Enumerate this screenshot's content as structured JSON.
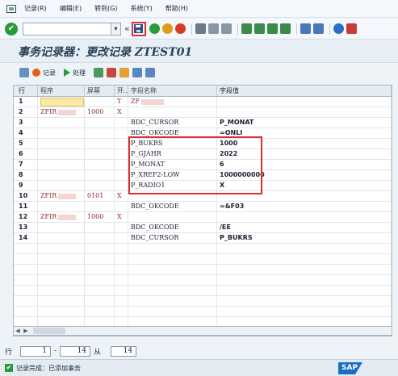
{
  "menu": {
    "items": [
      "记录(R)",
      "编辑(E)",
      "转到(G)",
      "系统(Y)",
      "帮助(H)"
    ]
  },
  "toolbar": {
    "command_value": "",
    "icons": [
      "ok-icon",
      "save-icon",
      "back-icon",
      "exit-icon",
      "cancel-icon",
      "print-icon",
      "find-icon",
      "find-next-icon",
      "first-page-icon",
      "prev-page-icon",
      "next-page-icon",
      "last-page-icon",
      "new-session-icon",
      "shortcut-icon",
      "help-icon",
      "layout-icon"
    ]
  },
  "title": "事务记录器：更改记录 ZTEST01",
  "app_toolbar": {
    "record_label": "记录",
    "process_label": "处理"
  },
  "table": {
    "headers": [
      "行",
      "程序",
      "屏幕",
      "开...",
      "字段名称",
      "字段值"
    ],
    "rows": [
      {
        "row": "1",
        "program": "",
        "screen": "",
        "start": "T",
        "field": "ZF",
        "value": ""
      },
      {
        "row": "2",
        "program": "ZFIR",
        "screen": "1000",
        "start": "X",
        "field": "",
        "value": ""
      },
      {
        "row": "3",
        "program": "",
        "screen": "",
        "start": "",
        "field": "BDC_CURSOR",
        "value": "P_MONAT"
      },
      {
        "row": "4",
        "program": "",
        "screen": "",
        "start": "",
        "field": "BDC_OKCODE",
        "value": "=ONLI"
      },
      {
        "row": "5",
        "program": "",
        "screen": "",
        "start": "",
        "field": "P_BUKRS",
        "value": "1000"
      },
      {
        "row": "6",
        "program": "",
        "screen": "",
        "start": "",
        "field": "P_GJAHR",
        "value": "2022"
      },
      {
        "row": "7",
        "program": "",
        "screen": "",
        "start": "",
        "field": "P_MONAT",
        "value": " 6"
      },
      {
        "row": "8",
        "program": "",
        "screen": "",
        "start": "",
        "field": "P_XREF2-LOW",
        "value": "1000000000"
      },
      {
        "row": "9",
        "program": "",
        "screen": "",
        "start": "",
        "field": "P_RADIO1",
        "value": "X"
      },
      {
        "row": "10",
        "program": "ZFIR",
        "screen": "0101",
        "start": "X",
        "field": "",
        "value": ""
      },
      {
        "row": "11",
        "program": "",
        "screen": "",
        "start": "",
        "field": "BDC_OKCODE",
        "value": "=&F03"
      },
      {
        "row": "12",
        "program": "ZFIR",
        "screen": "1000",
        "start": "X",
        "field": "",
        "value": ""
      },
      {
        "row": "13",
        "program": "",
        "screen": "",
        "start": "",
        "field": "BDC_OKCODE",
        "value": "/EE"
      },
      {
        "row": "14",
        "program": "",
        "screen": "",
        "start": "",
        "field": "BDC_CURSOR",
        "value": "P_BUKRS"
      }
    ]
  },
  "footer": {
    "row_label": "行",
    "from_value": "1",
    "dash": "-",
    "to_value": "14",
    "of_label": "从",
    "total_value": "14"
  },
  "status": {
    "message": "记录完成：已添加事务",
    "logo_text": "SAP"
  }
}
